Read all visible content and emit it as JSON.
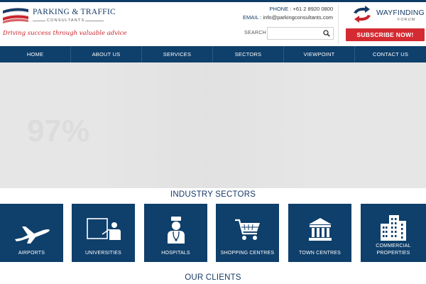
{
  "header": {
    "logo_title": "PARKING & TRAFFIC",
    "logo_sub": "CONSULTANTS",
    "tagline": "Driving success through valuable advice",
    "phone_label": "PHONE :",
    "phone": "+61 2 8920 0800",
    "email_label": "EMAIL :",
    "email": "info@parkingconsultants.com",
    "search_label": "SEARCH",
    "search_placeholder": "",
    "wayfinding_title": "WAYFINDING",
    "wayfinding_sub": "FORUM",
    "subscribe_label": "SUBSCRIBE NOW!"
  },
  "nav": {
    "items": [
      "HOME",
      "ABOUT US",
      "SERVICES",
      "SECTORS",
      "VIEWPOINT",
      "CONTACT US"
    ]
  },
  "hero": {
    "watermark": "97%"
  },
  "sectors": {
    "heading": "INDUSTRY SECTORS",
    "tiles": [
      {
        "label": "AIRPORTS",
        "icon": "airplane-icon"
      },
      {
        "label": "UNIVERSITIES",
        "icon": "lecturer-icon"
      },
      {
        "label": "HOSPITALS",
        "icon": "nurse-icon"
      },
      {
        "label": "SHOPPING CENTRES",
        "icon": "shopping-cart-icon"
      },
      {
        "label": "TOWN CENTRES",
        "icon": "civic-building-icon"
      },
      {
        "label": "COMMERCIAL PROPERTIES",
        "icon": "office-buildings-icon"
      }
    ]
  },
  "clients": {
    "heading": "OUR CLIENTS"
  },
  "colors": {
    "navy": "#0f3f6b",
    "brand_red": "#d42a32",
    "hero_grey": "#e6e6e6"
  }
}
